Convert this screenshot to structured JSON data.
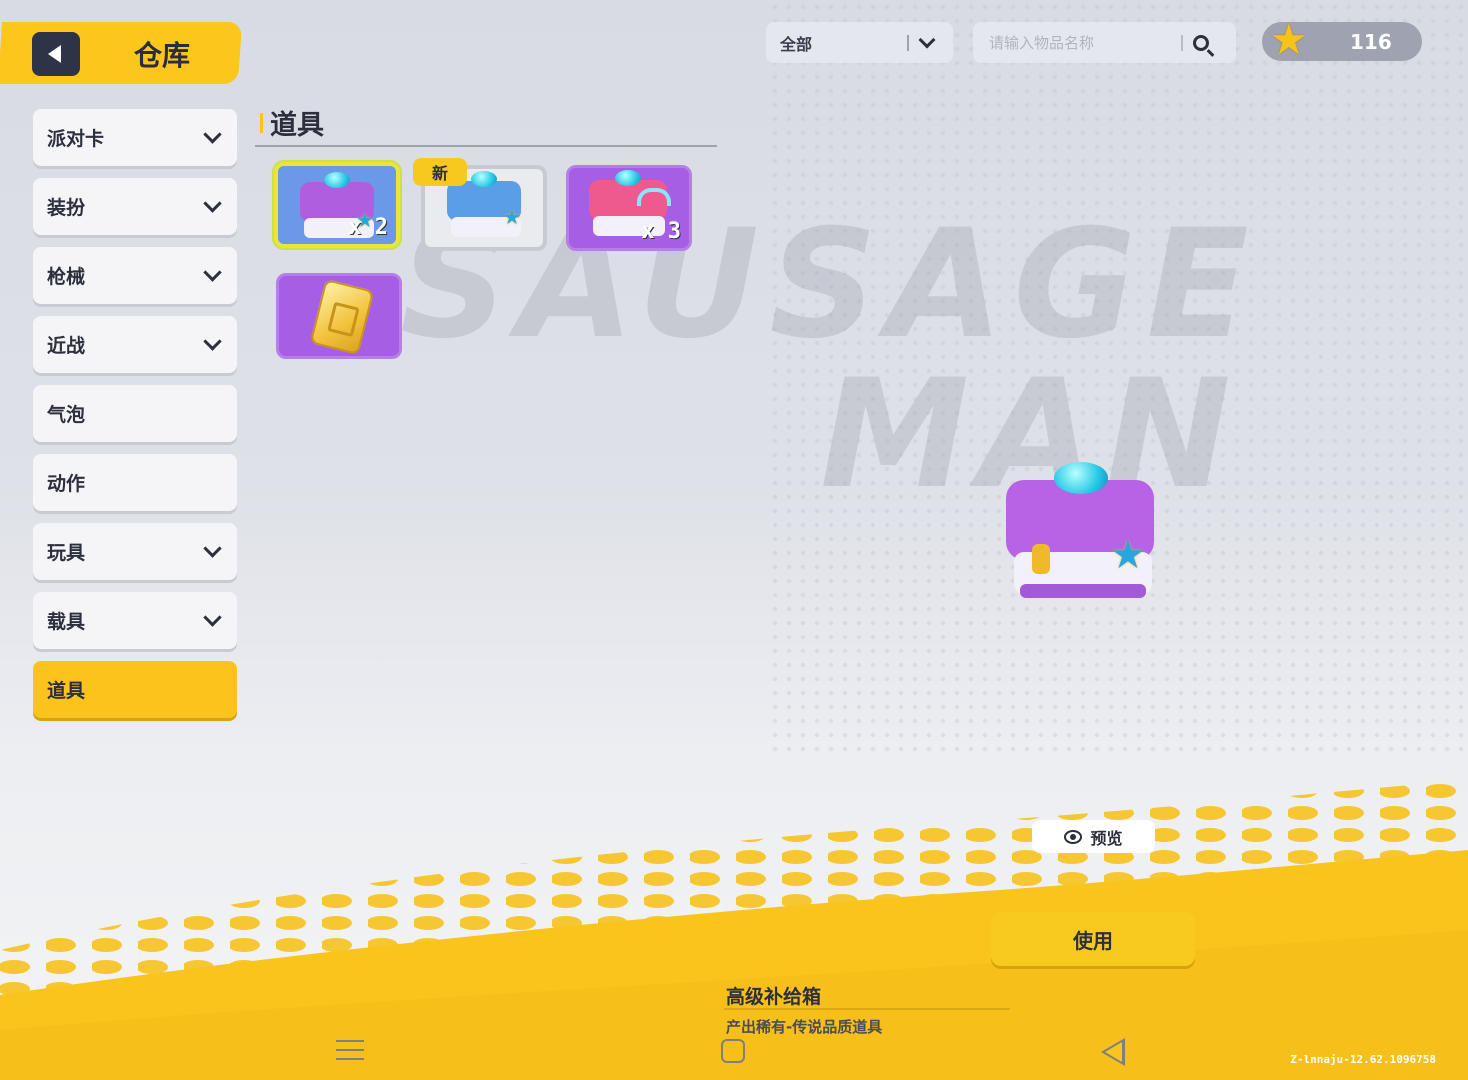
{
  "header": {
    "title": "仓库",
    "back_icon": "back-arrow-icon"
  },
  "sidebar": {
    "items": [
      {
        "label": "派对卡",
        "expandable": true,
        "active": false
      },
      {
        "label": "装扮",
        "expandable": true,
        "active": false
      },
      {
        "label": "枪械",
        "expandable": true,
        "active": false
      },
      {
        "label": "近战",
        "expandable": true,
        "active": false
      },
      {
        "label": "气泡",
        "expandable": false,
        "active": false
      },
      {
        "label": "动作",
        "expandable": false,
        "active": false
      },
      {
        "label": "玩具",
        "expandable": true,
        "active": false
      },
      {
        "label": "载具",
        "expandable": true,
        "active": false
      },
      {
        "label": "道具",
        "expandable": false,
        "active": true
      }
    ]
  },
  "topbar": {
    "filter_value": "全部",
    "search_placeholder": "请输入物品名称",
    "coins": "116"
  },
  "section": {
    "title": "道具"
  },
  "items": [
    {
      "name": "supply-box-purple",
      "quantity": "x 2",
      "selected": true,
      "new": false
    },
    {
      "name": "supply-box-blue",
      "quantity": "",
      "selected": false,
      "new": true
    },
    {
      "name": "supply-box-rainbow",
      "quantity": "x 3",
      "selected": false,
      "new": false
    },
    {
      "name": "golden-ticket",
      "quantity": "",
      "selected": false,
      "new": false
    }
  ],
  "new_badge": "新",
  "background_logo": [
    "SAUSAGE",
    "MAN"
  ],
  "detail": {
    "preview_label": "预览",
    "use_label": "使用",
    "item_name": "高级补给箱",
    "item_desc": "产出稀有-传说品质道具"
  },
  "footer": {
    "version": "Z-lnnaju-12.62.1096758"
  },
  "colors": {
    "accent": "#fbc31b",
    "dark": "#2c2f3d",
    "card_blue": "#6b98e8",
    "card_purple": "#a65ee4"
  }
}
